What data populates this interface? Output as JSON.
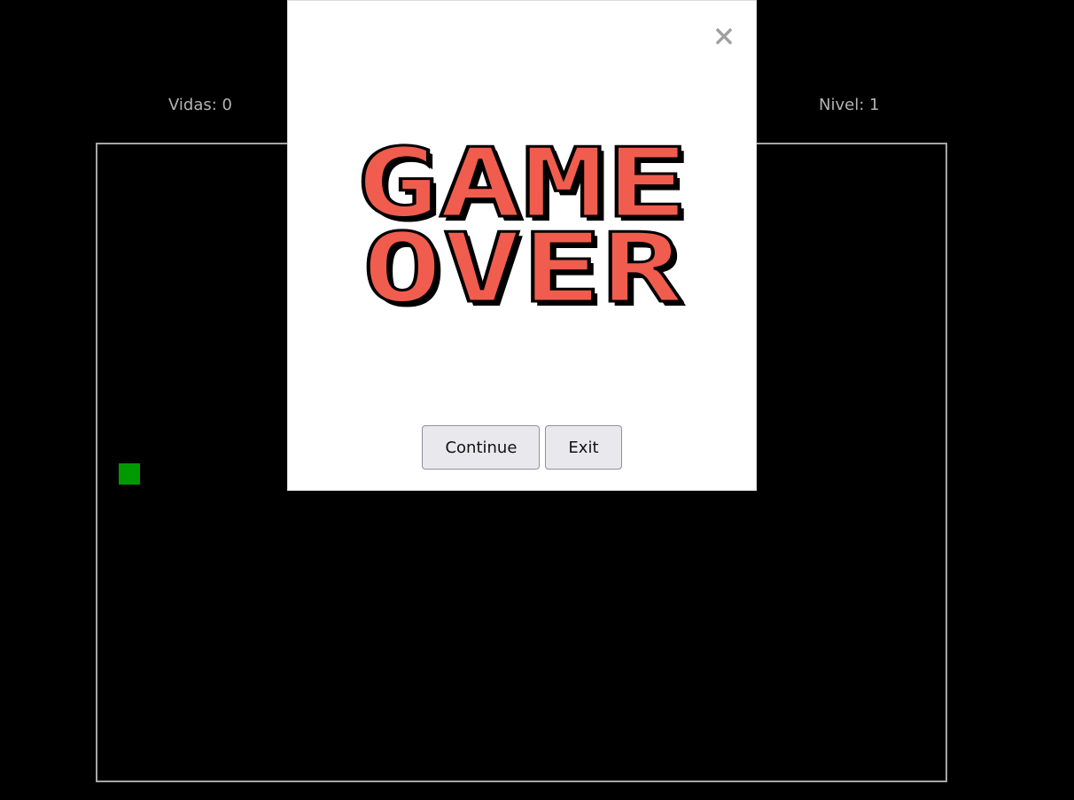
{
  "hud": {
    "lives": "Vidas: 0",
    "level": "Nivel: 1"
  },
  "board": {
    "snake_color": "#009900",
    "border_color": "#a6a6a6"
  },
  "modal": {
    "close_icon": "close-icon",
    "title_line1": "GAME",
    "title_line2": "OVER",
    "title_color": "#f05d4e",
    "buttons": {
      "continue": "Continue",
      "exit": "Exit"
    }
  }
}
